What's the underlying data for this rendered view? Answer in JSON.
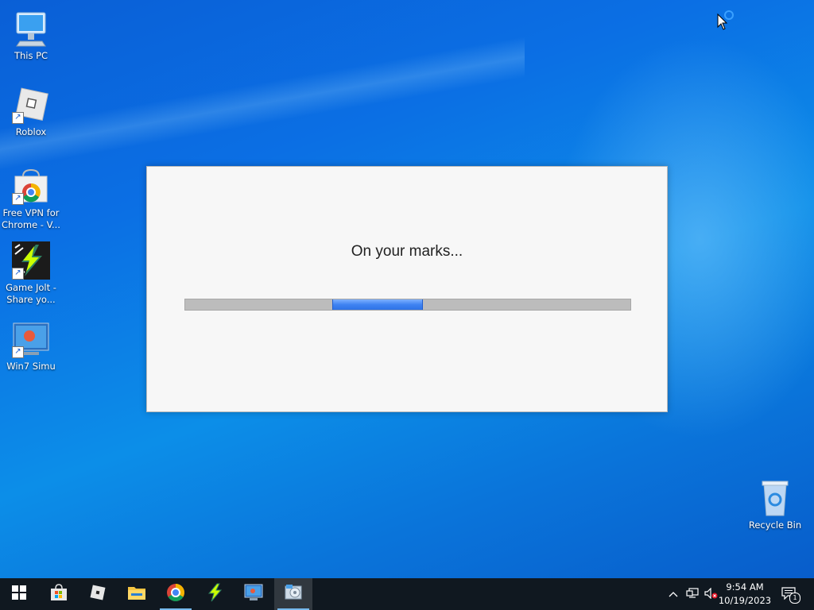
{
  "desktop": {
    "icons": [
      {
        "label": "This PC",
        "icon": "computer-icon"
      },
      {
        "label": "Roblox",
        "icon": "roblox-icon"
      },
      {
        "label": "Free VPN for Chrome - V...",
        "icon": "chrome-webstore-icon"
      },
      {
        "label": "Game Jolt - Share yo...",
        "icon": "game-jolt-icon"
      },
      {
        "label": "Win7 Simu",
        "icon": "win7-simu-icon"
      }
    ],
    "recycle_bin": {
      "label": "Recycle Bin",
      "icon": "recycle-bin-icon"
    }
  },
  "dialog": {
    "message": "On your marks...",
    "progress": {
      "start": 0.33,
      "end": 0.53
    }
  },
  "taskbar": {
    "apps": [
      "start-icon",
      "microsoft-store-icon",
      "roblox-icon",
      "file-explorer-icon",
      "chrome-icon",
      "game-jolt-icon",
      "win7-simu-icon",
      "loading-app-icon"
    ],
    "active_app": "loading-app-icon",
    "tray_icons": [
      "chevron-up-icon",
      "network-icon",
      "volume-muted-icon"
    ],
    "time": "9:54 AM",
    "date": "10/19/2023",
    "notification_count": "1"
  },
  "colors": {
    "accent": "#3f83f2",
    "taskbar": "#101820",
    "desktop": "#0b6fe4"
  }
}
